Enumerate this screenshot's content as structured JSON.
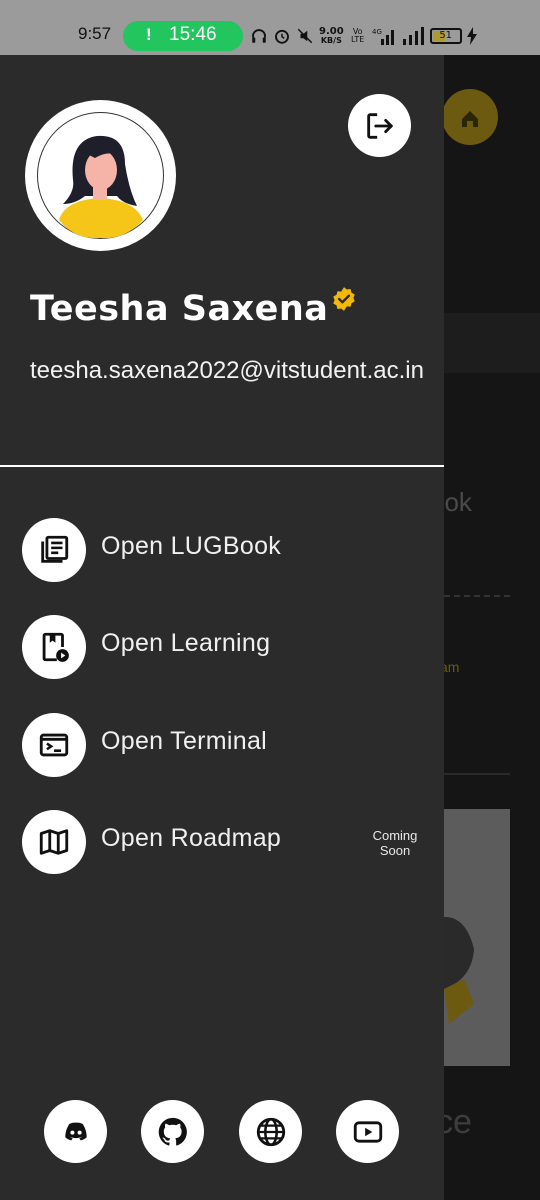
{
  "status_bar": {
    "time": "9:57",
    "call_timer": "15:46",
    "net_speed": "9.00",
    "net_unit": "KB/S",
    "volte": "Vo LTE",
    "network": "4G",
    "battery": "51"
  },
  "profile": {
    "name": "Teesha Saxena",
    "email": "teesha.saxena2022@vitstudent.ac.in",
    "verified": true
  },
  "menu": [
    {
      "label": "Open LUGBook",
      "icon": "book-icon"
    },
    {
      "label": "Open Learning",
      "icon": "learning-icon"
    },
    {
      "label": "Open Terminal",
      "icon": "terminal-icon"
    },
    {
      "label": "Open Roadmap",
      "icon": "map-icon",
      "badge": "Coming Soon"
    }
  ],
  "social": [
    {
      "name": "discord",
      "icon": "discord-icon"
    },
    {
      "name": "github",
      "icon": "github-icon"
    },
    {
      "name": "website",
      "icon": "globe-icon"
    },
    {
      "name": "youtube",
      "icon": "youtube-icon"
    }
  ],
  "background": {
    "text_fragment_1": "ook",
    "text_fragment_2": "am",
    "text_fragment_3": "ce"
  },
  "colors": {
    "drawer_bg": "#2b2b2b",
    "accent_gold": "#f2b807",
    "call_green": "#22c55e"
  }
}
